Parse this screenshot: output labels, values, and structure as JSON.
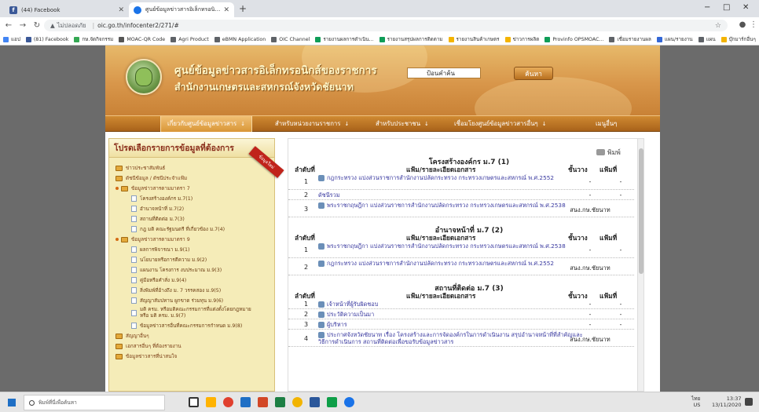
{
  "browser": {
    "tabs": [
      {
        "title": "(44) Facebook",
        "favicon": "facebook-icon",
        "active": false
      },
      {
        "title": "ศูนย์ข้อมูลข่าวสารอิเล็กทรอนิกส์ข",
        "favicon": "globe-icon",
        "active": true
      }
    ],
    "new_tab": "+",
    "window_controls": {
      "minimize": "−",
      "maximize": "□",
      "close": "✕"
    },
    "address": {
      "not_secure": "ไม่ปลอดภัย",
      "url": "oic.go.th/infocenter2/271/#"
    },
    "bookmarks": [
      {
        "label": "แอป",
        "color": "#4285f4"
      },
      {
        "label": "(81) Facebook",
        "color": "#3b5998"
      },
      {
        "label": "กษ.จัดกิจกรรม",
        "color": "#34a853"
      },
      {
        "label": "MOAC-QR Code",
        "color": "#555555"
      },
      {
        "label": "Agri Product",
        "color": "#5f6368"
      },
      {
        "label": "eBMN Application",
        "color": "#5f6368"
      },
      {
        "label": "OIC Channel",
        "color": "#5f6368"
      },
      {
        "label": "รายงานผลการดำเนิน...",
        "color": "#0f9d58"
      },
      {
        "label": "รายงานสรุปผลการติดตาม",
        "color": "#0f9d58"
      },
      {
        "label": "รายงานสินค้าเกษตร",
        "color": "#f4b400"
      },
      {
        "label": "ข่าวการผลิต",
        "color": "#f4b400"
      },
      {
        "label": "Provinfo OPSMOAC...",
        "color": "#0f9d58"
      },
      {
        "label": "เชื่อมรายงานผล",
        "color": "#5f6368"
      },
      {
        "label": "แผน/รายงาน",
        "color": "#3367d6"
      },
      {
        "label": "แผน",
        "color": "#5f6368"
      },
      {
        "label": "บุ๊กมาร์กอื่นๆ",
        "color": "#f4b400"
      }
    ]
  },
  "site": {
    "title_line1": "ศูนย์ข้อมูลข่าวสารอิเล็กทรอนิกส์ของราชการ",
    "title_line2": "สำนักงานเกษตรและสหกรณ์จังหวัดชัยนาท",
    "search_placeholder": "ป้อนคำค้น",
    "search_button": "ค้นหา",
    "nav": [
      {
        "label": "เกี่ยวกับศูนย์ข้อมูลข่าวสาร",
        "arrow": "↓",
        "selected": true
      },
      {
        "label": "สำหรับหน่วยงานราชการ",
        "arrow": "↓",
        "selected": false
      },
      {
        "label": "สำหรับประชาชน",
        "arrow": "↓",
        "selected": false
      },
      {
        "label": "เชื่อมโยงศูนย์ข้อมูลข่าวสารอื่นๆ",
        "arrow": "↓",
        "selected": false
      },
      {
        "label": "เมนูอื่นๆ",
        "arrow": "",
        "selected": false
      }
    ]
  },
  "left_panel": {
    "title": "โปรดเลือกรายการข้อมูลที่ต้องการ",
    "ribbon": "ข้อมูลใหม่",
    "items": [
      {
        "label": "ข่าวประชาสัมพันธ์",
        "type": "folder",
        "level": 1
      },
      {
        "label": "ดัชนีข้อมูล / ดัชนีประจำแฟ้ม",
        "type": "folder",
        "level": 1
      },
      {
        "label": "ข้อมูลข่าวสารตามมาตรา 7",
        "type": "folder-open",
        "level": 1
      },
      {
        "label": "โครงสร้างองค์กร ม.7(1)",
        "type": "doc",
        "level": 2
      },
      {
        "label": "อำนาจหน้าที่ ม.7(2)",
        "type": "doc",
        "level": 2
      },
      {
        "label": "สถานที่ติดต่อ ม.7(3)",
        "type": "doc",
        "level": 2
      },
      {
        "label": "กฎ มติ คณะรัฐมนตรี ที่เกี่ยวข้อง ม.7(4)",
        "type": "doc",
        "level": 2
      },
      {
        "label": "ข้อมูลข่าวสารตามมาตรา 9",
        "type": "folder-open",
        "level": 1
      },
      {
        "label": "ผลการพิจารณา ม.9(1)",
        "type": "doc",
        "level": 2
      },
      {
        "label": "นโยบายหรือการตีความ ม.9(2)",
        "type": "doc",
        "level": 2
      },
      {
        "label": "แผนงาน โครงการ งบประมาณ ม.9(3)",
        "type": "doc",
        "level": 2
      },
      {
        "label": "คู่มือหรือคำสั่ง ม.9(4)",
        "type": "doc",
        "level": 2
      },
      {
        "label": "สิ่งพิมพ์ที่อ้างถึง ม. 7 วรรคสอง ม.9(5)",
        "type": "doc",
        "level": 2
      },
      {
        "label": "สัญญาสัมปทาน ผูกขาด ร่วมทุน ม.9(6)",
        "type": "doc",
        "level": 2
      },
      {
        "label": "มติ ครม. หรือมติคณะกรรมการที่แต่งตั้งโดยกฎหมาย หรือ มติ ครม. ม.9(7)",
        "type": "doc",
        "level": 2
      },
      {
        "label": "ข้อมูลข่าวสารอื่นที่คณะกรรมการกำหนด ม.9(8)",
        "type": "doc",
        "level": 2
      },
      {
        "label": "สัญญาอื่นๆ",
        "type": "folder",
        "level": 1
      },
      {
        "label": "เอกสารอื่นๆ ที่ต้องรายงาน",
        "type": "folder",
        "level": 1
      },
      {
        "label": "ข้อมูลข่าวสารที่น่าสนใจ",
        "type": "folder",
        "level": 1
      }
    ]
  },
  "right_panel": {
    "print_label": "พิมพ์",
    "col_no": "ลำดับที่",
    "col_doc": "แฟ้ม/รายละเอียดเอกสาร",
    "col_shelf": "ชั้นวาง",
    "col_file": "แฟ้มที่",
    "sections": [
      {
        "title": "โครงสร้างองค์กร ม.7 (1)",
        "rows": [
          {
            "no": "1",
            "text": "กฎกระทรวง แบ่งส่วนราชการสำนักงานปลัดกระทรวง กระทรวงเกษตรและสหกรณ์ พ.ศ.2552",
            "shelf": "-",
            "file": "-",
            "icon": true
          },
          {
            "no": "2",
            "text": "ดัชนีรวม",
            "shelf": "-",
            "file": "-",
            "icon": false
          },
          {
            "no": "3",
            "text": "พระราชกฤษฎีกา แบ่งส่วนราชการสำนักงานปลัดกระทรวง กระทรวงเกษตรและสหกรณ์ พ.ศ.2538",
            "shelf": "สนง.กษ.ชัยนาท",
            "file": "",
            "icon": true
          }
        ]
      },
      {
        "title": "อำนาจหน้าที่ ม.7 (2)",
        "rows": [
          {
            "no": "1",
            "text": "พระราชกฤษฎีกา แบ่งส่วนราชการสำนักงานปลัดกระทรวง กระทรวงเกษตรและสหกรณ์ พ.ศ.2538",
            "shelf": "-",
            "file": "-",
            "icon": true
          },
          {
            "no": "2",
            "text": "กฎกระทรวง แบ่งส่วนราชการสำนักงานปลัดกระทรวง กระทรวงเกษตรและสหกรณ์ พ.ศ.2552",
            "shelf": "สนง.กษ.ชัยนาท",
            "file": "",
            "icon": true
          }
        ]
      },
      {
        "title": "สถานที่ติดต่อ ม.7 (3)",
        "rows": [
          {
            "no": "1",
            "text": "เจ้าหน้าที่ผู้รับผิดชอบ",
            "shelf": "-",
            "file": "-",
            "icon": true
          },
          {
            "no": "2",
            "text": "ประวัติความเป็นมา",
            "shelf": "-",
            "file": "-",
            "icon": true
          },
          {
            "no": "3",
            "text": "ผู้บริหาร",
            "shelf": "-",
            "file": "-",
            "icon": true
          },
          {
            "no": "4",
            "text": "ประกาศจังหวัดชัยนาท เรื่อง โครงสร้างและการจัดองค์กรในการดำเนินงาน สรุปอำนาจหน้าที่ที่สำคัญและวิธีการดำเนินการ สถานที่ติดต่อเพื่อขอรับข้อมูลข่าวสาร",
            "shelf": "สนง.กษ.ชัยนาท",
            "file": "",
            "icon": true
          }
        ]
      }
    ]
  },
  "taskbar": {
    "search_placeholder": "พิมพ์ที่นี่เพื่อค้นหา",
    "clock_time": "13:37",
    "clock_date": "13/11/2020",
    "lang_line1": "ไทย",
    "lang_line2": "US"
  }
}
